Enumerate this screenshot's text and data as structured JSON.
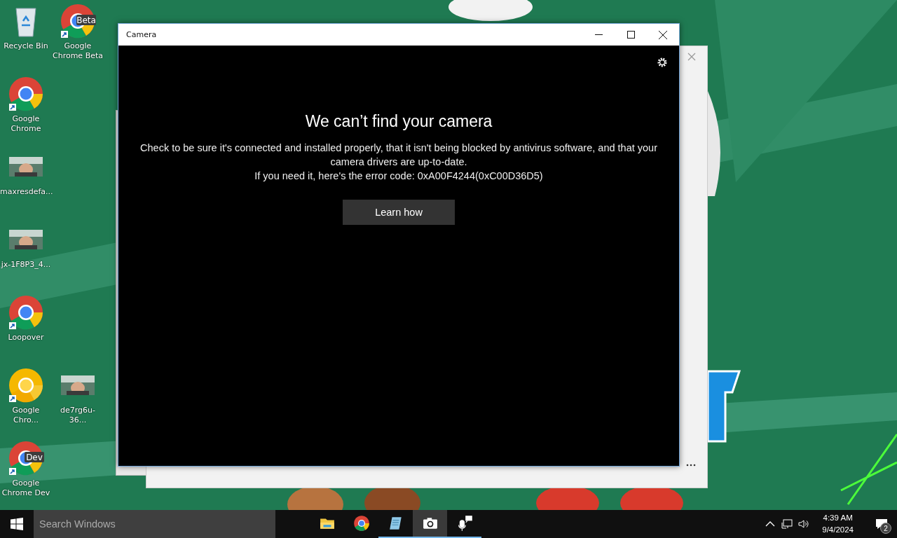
{
  "desktop_icons": [
    [
      {
        "kind": "recycle-bin",
        "label": "Recycle Bin"
      },
      {
        "kind": "chrome",
        "badge": "Beta",
        "label": "Google Chrome Beta"
      }
    ],
    [
      {
        "kind": "chrome",
        "label": "Google Chrome"
      }
    ],
    [
      {
        "label": "maxresdefa..."
      }
    ],
    [
      {
        "label": "jx-1F8P3_4..."
      }
    ],
    [
      {
        "kind": "chrome",
        "label": "Loopover"
      }
    ],
    [
      {
        "kind": "chrome-canary",
        "label": "Google Chro..."
      },
      {
        "label": "de7rg6u-36..."
      }
    ],
    [
      {
        "kind": "chrome",
        "badge": "Dev",
        "label": "Google Chrome Dev"
      }
    ]
  ],
  "camera_window": {
    "title": "Camera",
    "heading": "We can’t find your camera",
    "message": "Check to be sure it's connected and installed properly, that it isn't being blocked by antivirus software, and that your camera drivers are up-to-date.",
    "error_line": "If you need it, here's the error code: 0xA00F4244(0xC00D36D5)",
    "button": "Learn how"
  },
  "taskbar": {
    "search": {
      "placeholder": "Search Windows"
    },
    "apps": [
      {
        "kind": "folder",
        "running": false,
        "selected": false
      },
      {
        "kind": "chrome",
        "running": false,
        "selected": false
      },
      {
        "kind": "notepad",
        "running": true,
        "selected": false
      },
      {
        "kind": "camera",
        "running": true,
        "selected": true
      },
      {
        "kind": "microphone",
        "running": true,
        "selected": false
      }
    ],
    "time": "4:39 AM",
    "date": "9/4/2024",
    "notifications": "2"
  }
}
